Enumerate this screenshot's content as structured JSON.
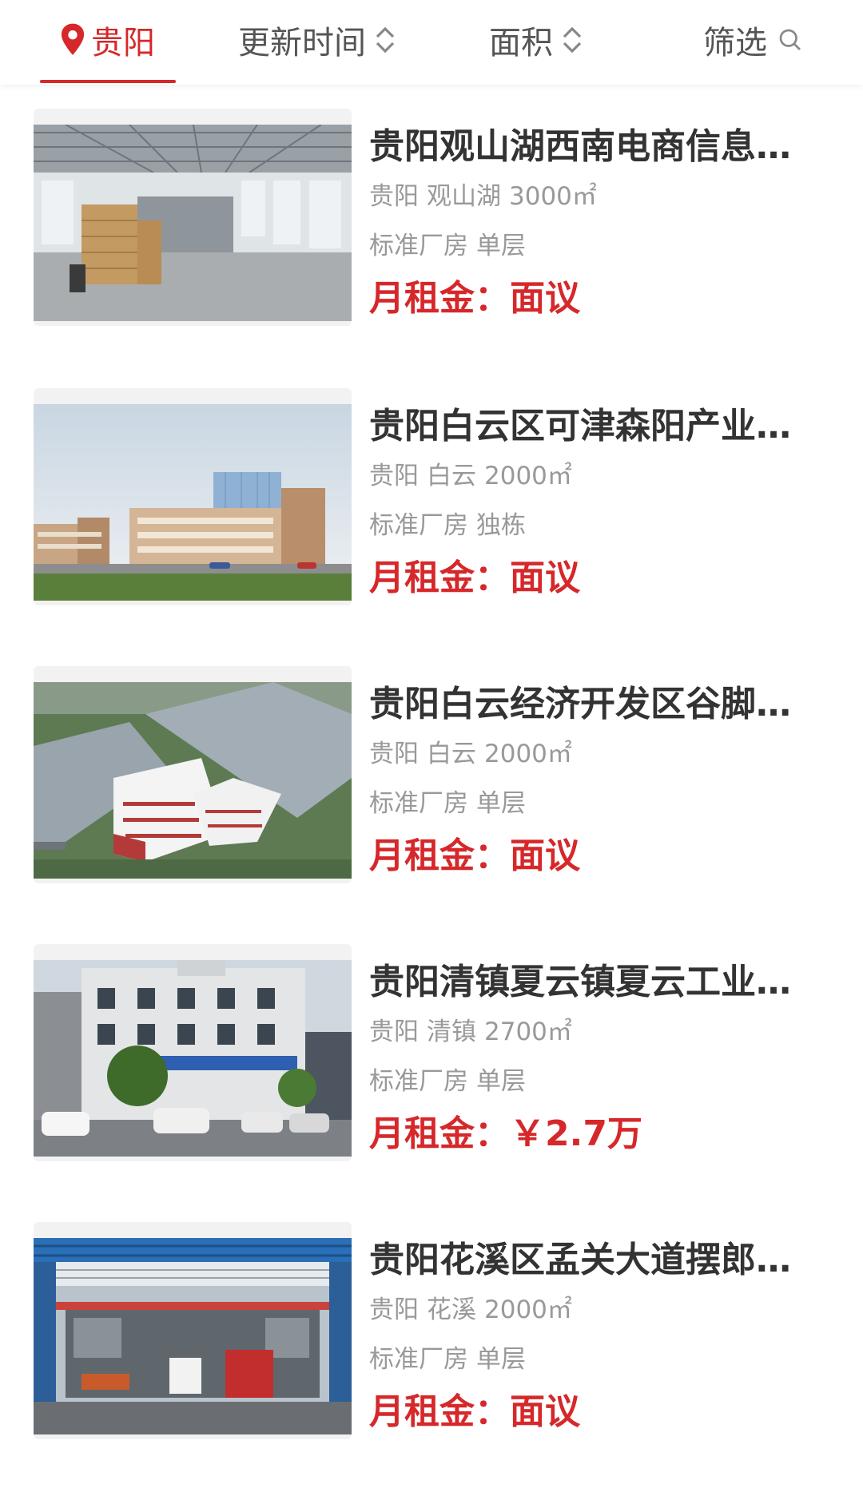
{
  "filter_bar": {
    "city": "贵阳",
    "sort_updated": "更新时间",
    "sort_area": "面积",
    "filter": "筛选"
  },
  "colors": {
    "accent": "#d6282a",
    "text_primary": "#333333",
    "text_secondary": "#999999"
  },
  "listings": [
    {
      "title": "贵阳观山湖西南电商信息…",
      "city": "贵阳",
      "district": "观山湖",
      "area": "3000㎡",
      "type": "标准厂房",
      "floors": "单层",
      "price_label": "月租金：",
      "price_value": "面议",
      "image": "warehouse-interior"
    },
    {
      "title": "贵阳白云区可津森阳产业…",
      "city": "贵阳",
      "district": "白云",
      "area": "2000㎡",
      "type": "标准厂房",
      "floors": "独栋",
      "price_label": "月租金：",
      "price_value": "面议",
      "image": "industrial-park-exterior"
    },
    {
      "title": "贵阳白云经济开发区谷脚…",
      "city": "贵阳",
      "district": "白云",
      "area": "2000㎡",
      "type": "标准厂房",
      "floors": "单层",
      "price_label": "月租金：",
      "price_value": "面议",
      "image": "factory-aerial-render"
    },
    {
      "title": "贵阳清镇夏云镇夏云工业…",
      "city": "贵阳",
      "district": "清镇",
      "area": "2700㎡",
      "type": "标准厂房",
      "floors": "单层",
      "price_label": "月租金：",
      "price_value": "￥2.7万",
      "image": "office-building-street"
    },
    {
      "title": "贵阳花溪区孟关大道摆郎…",
      "city": "贵阳",
      "district": "花溪",
      "area": "2000㎡",
      "type": "标准厂房",
      "floors": "单层",
      "price_label": "月租金：",
      "price_value": "面议",
      "image": "steel-shed-trucks"
    }
  ]
}
